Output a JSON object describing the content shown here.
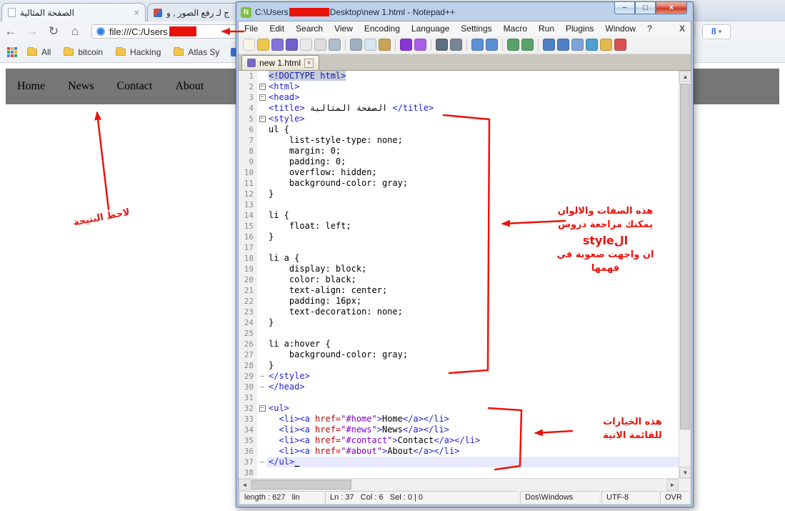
{
  "browser": {
    "tabs": [
      {
        "title": "الصفحة المثالية"
      },
      {
        "title": "ج لـ رفع الصور , و"
      }
    ],
    "address": {
      "url": "file:///C:/Users"
    },
    "bookmarks": [
      "All",
      "bitcoin",
      "Hacking",
      "Atlas Sy"
    ],
    "page_nav": [
      "Home",
      "News",
      "Contact",
      "About"
    ],
    "grid_colors": [
      "#e8453c",
      "#f5b400",
      "#4688f1",
      "#3aa757",
      "#4688f1",
      "#f5b400",
      "#4688f1",
      "#e8453c",
      "#3aa757"
    ],
    "icons": {
      "back": "←",
      "forward": "→",
      "reload": "↻",
      "home": "⌂",
      "close": "×",
      "google": "8",
      "caret": "▾"
    }
  },
  "notepad": {
    "title_prefix": "C:\\Users",
    "title_suffix": "Desktop\\new 1.html - Notepad++",
    "menu": [
      "File",
      "Edit",
      "Search",
      "View",
      "Encoding",
      "Language",
      "Settings",
      "Macro",
      "Run",
      "Plugins",
      "Window",
      "?"
    ],
    "menu_close": "X",
    "doc_tab": "new 1.html",
    "toolbar_icons": [
      {
        "name": "new-file",
        "color": "#f7f4e8"
      },
      {
        "name": "open-folder",
        "color": "#edc64f"
      },
      {
        "name": "save",
        "color": "#8274d8"
      },
      {
        "name": "save-all",
        "color": "#6f60cc"
      },
      {
        "name": "close-file",
        "color": "#e9e9e9"
      },
      {
        "name": "close-all",
        "color": "#dcdcdc"
      },
      {
        "name": "print",
        "color": "#aebccd"
      },
      {
        "name": "sep"
      },
      {
        "name": "cut",
        "color": "#9fb0c0"
      },
      {
        "name": "copy",
        "color": "#d7e4f2"
      },
      {
        "name": "paste",
        "color": "#c9a257"
      },
      {
        "name": "sep"
      },
      {
        "name": "undo",
        "color": "#8a35d6"
      },
      {
        "name": "redo",
        "color": "#ab5fe8"
      },
      {
        "name": "sep"
      },
      {
        "name": "find",
        "color": "#5d6f81"
      },
      {
        "name": "replace",
        "color": "#76879a"
      },
      {
        "name": "sep"
      },
      {
        "name": "zoom-in",
        "color": "#5b8fd6"
      },
      {
        "name": "zoom-out",
        "color": "#5b8fd6"
      },
      {
        "name": "sep"
      },
      {
        "name": "sync-vertical",
        "color": "#58a468"
      },
      {
        "name": "sync-horizontal",
        "color": "#58a468"
      },
      {
        "name": "sep"
      },
      {
        "name": "word-wrap",
        "color": "#4f7fc4"
      },
      {
        "name": "show-all-characters",
        "color": "#4f7fc4"
      },
      {
        "name": "indent-guide",
        "color": "#7ea3d8"
      },
      {
        "name": "function-list",
        "color": "#4f9fd0"
      },
      {
        "name": "document-map",
        "color": "#e3b94e"
      },
      {
        "name": "macro-record",
        "color": "#d65050"
      }
    ],
    "code_lines": [
      {
        "fold": "",
        "cur": false,
        "toks": [
          [
            "dt",
            "<!DOCTYPE html>"
          ]
        ]
      },
      {
        "fold": "start",
        "cur": false,
        "toks": [
          [
            "tag",
            "<html>"
          ]
        ]
      },
      {
        "fold": "start",
        "cur": false,
        "toks": [
          [
            "tag",
            "<head>"
          ]
        ]
      },
      {
        "fold": "",
        "cur": false,
        "toks": [
          [
            "tag",
            "<title>"
          ],
          [
            "txt",
            " الصفحة المثالية "
          ],
          [
            "tag",
            "</title>"
          ]
        ]
      },
      {
        "fold": "start",
        "cur": false,
        "toks": [
          [
            "tag",
            "<style>"
          ]
        ]
      },
      {
        "fold": "",
        "cur": false,
        "toks": [
          [
            "txt",
            "ul {"
          ]
        ]
      },
      {
        "fold": "",
        "cur": false,
        "toks": [
          [
            "txt",
            "    list-style-type: none;"
          ]
        ]
      },
      {
        "fold": "",
        "cur": false,
        "toks": [
          [
            "txt",
            "    margin: 0;"
          ]
        ]
      },
      {
        "fold": "",
        "cur": false,
        "toks": [
          [
            "txt",
            "    padding: 0;"
          ]
        ]
      },
      {
        "fold": "",
        "cur": false,
        "toks": [
          [
            "txt",
            "    overflow: hidden;"
          ]
        ]
      },
      {
        "fold": "",
        "cur": false,
        "toks": [
          [
            "txt",
            "    background-color: gray;"
          ]
        ]
      },
      {
        "fold": "",
        "cur": false,
        "toks": [
          [
            "txt",
            "}"
          ]
        ]
      },
      {
        "fold": "",
        "cur": false,
        "toks": []
      },
      {
        "fold": "",
        "cur": false,
        "toks": [
          [
            "txt",
            "li {"
          ]
        ]
      },
      {
        "fold": "",
        "cur": false,
        "toks": [
          [
            "txt",
            "    float: left;"
          ]
        ]
      },
      {
        "fold": "",
        "cur": false,
        "toks": [
          [
            "txt",
            "}"
          ]
        ]
      },
      {
        "fold": "",
        "cur": false,
        "toks": []
      },
      {
        "fold": "",
        "cur": false,
        "toks": [
          [
            "txt",
            "li a {"
          ]
        ]
      },
      {
        "fold": "",
        "cur": false,
        "toks": [
          [
            "txt",
            "    display: block;"
          ]
        ]
      },
      {
        "fold": "",
        "cur": false,
        "toks": [
          [
            "txt",
            "    color: black;"
          ]
        ]
      },
      {
        "fold": "",
        "cur": false,
        "toks": [
          [
            "txt",
            "    text-align: center;"
          ]
        ]
      },
      {
        "fold": "",
        "cur": false,
        "toks": [
          [
            "txt",
            "    padding: 16px;"
          ]
        ]
      },
      {
        "fold": "",
        "cur": false,
        "toks": [
          [
            "txt",
            "    text-decoration: none;"
          ]
        ]
      },
      {
        "fold": "",
        "cur": false,
        "toks": [
          [
            "txt",
            "}"
          ]
        ]
      },
      {
        "fold": "",
        "cur": false,
        "toks": []
      },
      {
        "fold": "",
        "cur": false,
        "toks": [
          [
            "txt",
            "li a:hover {"
          ]
        ]
      },
      {
        "fold": "",
        "cur": false,
        "toks": [
          [
            "txt",
            "    background-color: gray;"
          ]
        ]
      },
      {
        "fold": "",
        "cur": false,
        "toks": [
          [
            "txt",
            "}"
          ]
        ]
      },
      {
        "fold": "end",
        "cur": false,
        "toks": [
          [
            "tag",
            "</style>"
          ]
        ]
      },
      {
        "fold": "end",
        "cur": false,
        "toks": [
          [
            "tag",
            "</head>"
          ]
        ]
      },
      {
        "fold": "",
        "cur": false,
        "toks": []
      },
      {
        "fold": "start",
        "cur": false,
        "toks": [
          [
            "tag",
            "<ul>"
          ]
        ]
      },
      {
        "fold": "",
        "cur": false,
        "toks": [
          [
            "txt",
            "  "
          ],
          [
            "tag",
            "<li><a "
          ],
          [
            "attr",
            "href="
          ],
          [
            "val",
            "\"#home\""
          ],
          [
            "tag",
            ">"
          ],
          [
            "txt",
            "Home"
          ],
          [
            "tag",
            "</a></li>"
          ]
        ]
      },
      {
        "fold": "",
        "cur": false,
        "toks": [
          [
            "txt",
            "  "
          ],
          [
            "tag",
            "<li><a "
          ],
          [
            "attr",
            "href="
          ],
          [
            "val",
            "\"#news\""
          ],
          [
            "tag",
            ">"
          ],
          [
            "txt",
            "News"
          ],
          [
            "tag",
            "</a></li>"
          ]
        ]
      },
      {
        "fold": "",
        "cur": false,
        "toks": [
          [
            "txt",
            "  "
          ],
          [
            "tag",
            "<li><a "
          ],
          [
            "attr",
            "href="
          ],
          [
            "val",
            "\"#contact\""
          ],
          [
            "tag",
            ">"
          ],
          [
            "txt",
            "Contact"
          ],
          [
            "tag",
            "</a></li>"
          ]
        ]
      },
      {
        "fold": "",
        "cur": false,
        "toks": [
          [
            "txt",
            "  "
          ],
          [
            "tag",
            "<li><a "
          ],
          [
            "attr",
            "href="
          ],
          [
            "val",
            "\"#about\""
          ],
          [
            "tag",
            ">"
          ],
          [
            "txt",
            "About"
          ],
          [
            "tag",
            "</a></li>"
          ]
        ]
      },
      {
        "fold": "end",
        "cur": true,
        "toks": [
          [
            "tag",
            "</ul>"
          ],
          [
            "cur",
            "_"
          ]
        ]
      },
      {
        "fold": "",
        "cur": false,
        "toks": []
      }
    ],
    "status": {
      "length_info": "length : 627   lin",
      "caret_info": "Ln : 37   Col : 6   Sel : 0 | 0",
      "eol": "Dos\\Windows",
      "encoding": "UTF-8",
      "mode": "OVR"
    }
  },
  "annotations": {
    "red": "#e8140c",
    "note_result": "لاحظ النتيجة",
    "style_note_lines": [
      "هذه الصفات والالوان",
      "يمكنك مراجعة دروس",
      "الstyle",
      "ان واجهت صعوبة في فهمها"
    ],
    "list_note_lines": [
      "هذه الخيارات",
      "للقائمة الاتية"
    ]
  },
  "window_icons": {
    "minimize": "−",
    "maximize": "□",
    "close": "×",
    "npp": "N",
    "up": "▲",
    "down": "▼",
    "left": "◄",
    "right": "►",
    "fold_collapse": "−",
    "fold_end": "–"
  }
}
